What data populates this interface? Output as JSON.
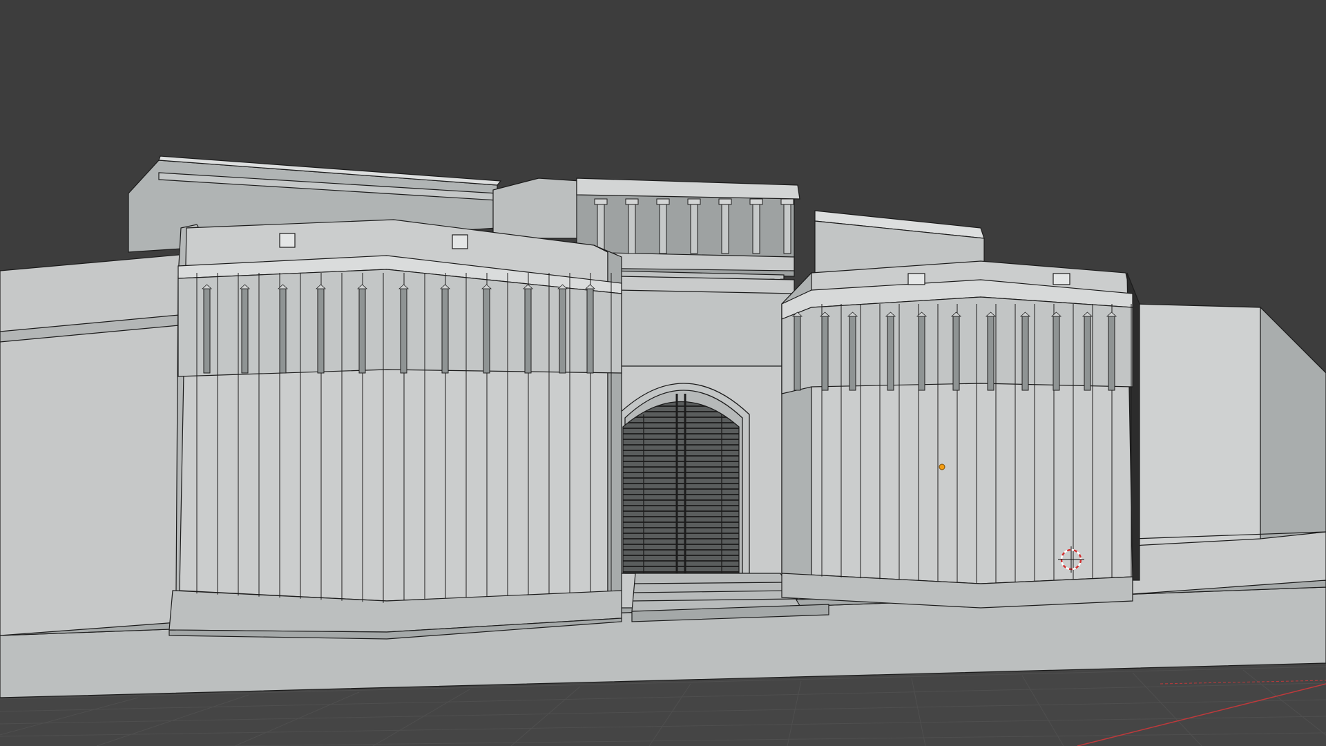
{
  "viewport": {
    "background": "#3d3d3d",
    "grid_color": "#454545",
    "grid_line_color": "#4f4f4f",
    "x_axis_color": "#c0393b"
  },
  "model": {
    "surface_light": "#cfd1d1",
    "surface_mid": "#bfc2c2",
    "surface_dark": "#a9adad",
    "wire_color": "#1c1c1c",
    "origin_color": "#f39c12",
    "cursor_color": "#d03030"
  }
}
